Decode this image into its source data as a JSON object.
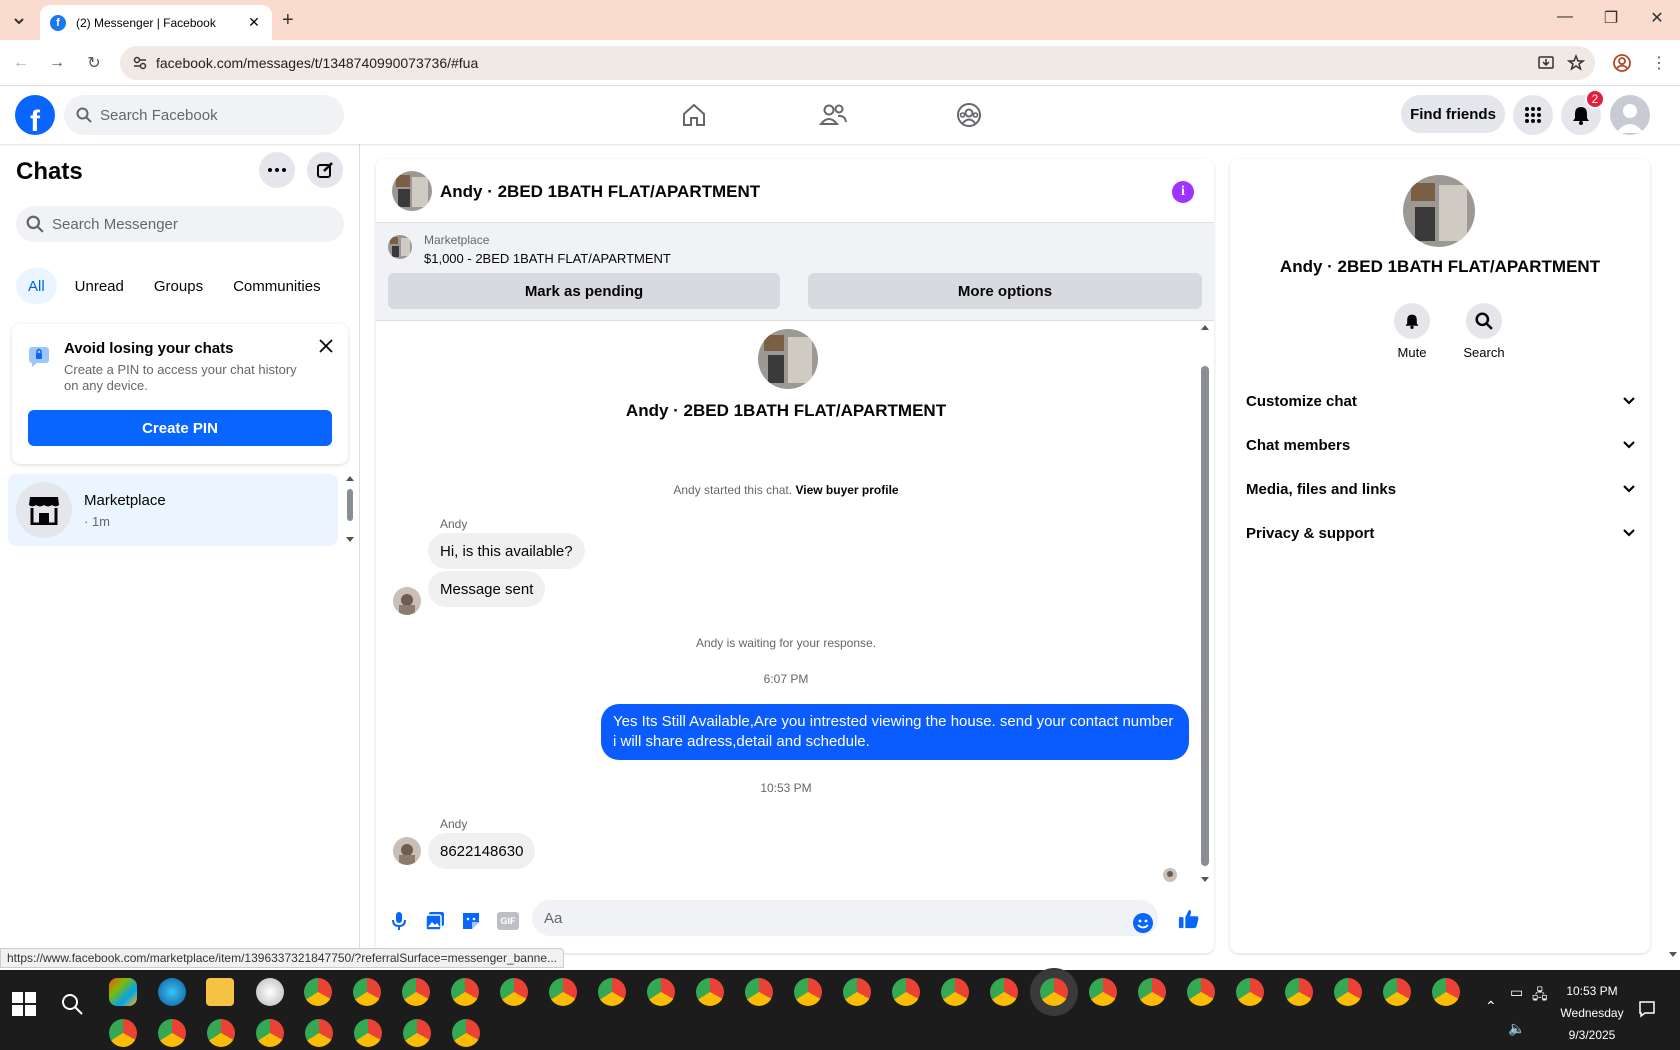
{
  "browser": {
    "tab_title": "(2) Messenger | Facebook",
    "url": "facebook.com/messages/t/1348740990073736/#fua",
    "status_url": "https://www.facebook.com/marketplace/item/1396337321847750/?referralSurface=messenger_banne..."
  },
  "header": {
    "search_placeholder": "Search Facebook",
    "find_friends": "Find friends",
    "notif_count": "2"
  },
  "left": {
    "title": "Chats",
    "search_placeholder": "Search Messenger",
    "filters": [
      "All",
      "Unread",
      "Groups",
      "Communities"
    ],
    "pin": {
      "title": "Avoid losing your chats",
      "desc": "Create a PIN to access your chat history on any device.",
      "button": "Create PIN"
    },
    "conversation": {
      "name": "Marketplace",
      "time": "· 1m"
    }
  },
  "chat": {
    "header_name": "Andy · 2BED 1BATH FLAT/APARTMENT",
    "marketplace_label": "Marketplace",
    "listing": "$1,000 - 2BED 1BATH FLAT/APARTMENT",
    "mark_pending": "Mark as pending",
    "more_options": "More options",
    "center_name": "Andy · 2BED 1BATH FLAT/APARTMENT",
    "started_text": "Andy started this chat.",
    "view_buyer": "View buyer profile",
    "sender": "Andy",
    "msg1": "Hi, is this available?",
    "msg2": "Message sent",
    "waiting": "Andy is waiting for your response.",
    "time1": "6:07 PM",
    "out_msg": "Yes Its Still Available,Are you intrested viewing the house. send your contact number i will share adress,detail and schedule.",
    "time2": "10:53 PM",
    "msg3": "8622148630",
    "composer_placeholder": "Aa",
    "gif_label": "GIF"
  },
  "right": {
    "name": "Andy · 2BED 1BATH FLAT/APARTMENT",
    "mute": "Mute",
    "search": "Search",
    "rows": [
      "Customize chat",
      "Chat members",
      "Media, files and links",
      "Privacy & support"
    ]
  },
  "taskbar": {
    "time": "10:53 PM",
    "day": "Wednesday",
    "date": "9/3/2025"
  },
  "colors": {
    "fb_blue": "#0866ff",
    "out_bubble": "#0a5cff",
    "info_purple": "#a033ff",
    "badge_red": "#e41e3f",
    "tabbar": "#f9dccd"
  }
}
